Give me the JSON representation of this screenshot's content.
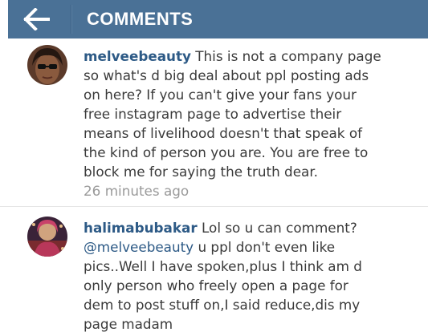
{
  "header": {
    "title": "COMMENTS",
    "back_icon": "arrow-left-icon",
    "background": "#4a7196"
  },
  "comments": [
    {
      "username": "melveebeauty",
      "lines": [
        "This is not a company page",
        "so what's d big deal about ppl posting ads",
        "on here? If you can't give your fans your",
        "free instagram page to advertise their",
        "means of livelihood doesn't that speak of",
        "the kind of person you are. You are free to",
        "block me for saying the truth dear."
      ],
      "time": "26 minutes ago"
    },
    {
      "username": "halimabubakar",
      "first_line": "Lol so u can comment?",
      "mention": "@melveebeauty",
      "mention_rest": " u ppl don't even like",
      "lines": [
        "pics..Well I have spoken,plus I think am d",
        "only person who freely open a page for",
        "dem to post stuff on,I said reduce,dis my",
        "page madam"
      ]
    }
  ],
  "colors": {
    "username": "#2d5a86",
    "text": "#3a3a3a",
    "timestamp": "#9a9a9a"
  }
}
